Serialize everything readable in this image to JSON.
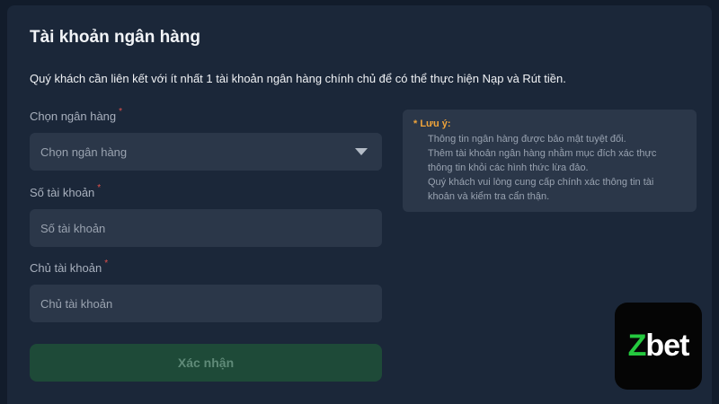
{
  "form": {
    "title": "Tài khoản ngân hàng",
    "description": "Quý khách cần liên kết với ít nhất 1 tài khoản ngân hàng chính chủ để có thể thực hiện Nạp và Rút tiền.",
    "bank": {
      "label": "Chọn ngân hàng",
      "required_mark": "*",
      "placeholder": "Chọn ngân hàng"
    },
    "account_number": {
      "label": "Số tài khoản",
      "required_mark": "*",
      "placeholder": "Số tài khoản"
    },
    "account_holder": {
      "label": "Chủ tài khoản",
      "required_mark": "*",
      "placeholder": "Chủ tài khoản"
    },
    "submit_label": "Xác nhận"
  },
  "note": {
    "title": "* Lưu ý:",
    "lines": [
      "Thông tin ngân hàng được bảo mật tuyệt đối.",
      "Thêm tài khoản ngân hàng nhằm mục đích xác thực",
      "thông tin khỏi các hình thức lừa đảo.",
      "Quý khách vui lòng cung cấp chính xác thông tin tài",
      "khoản và kiểm tra cẩn thận."
    ]
  },
  "logo": {
    "first_letter": "Z",
    "rest": "bet"
  },
  "colors": {
    "accent_green": "#25c93f",
    "warning_orange": "#f0a43a",
    "required_red": "#e2514c"
  }
}
